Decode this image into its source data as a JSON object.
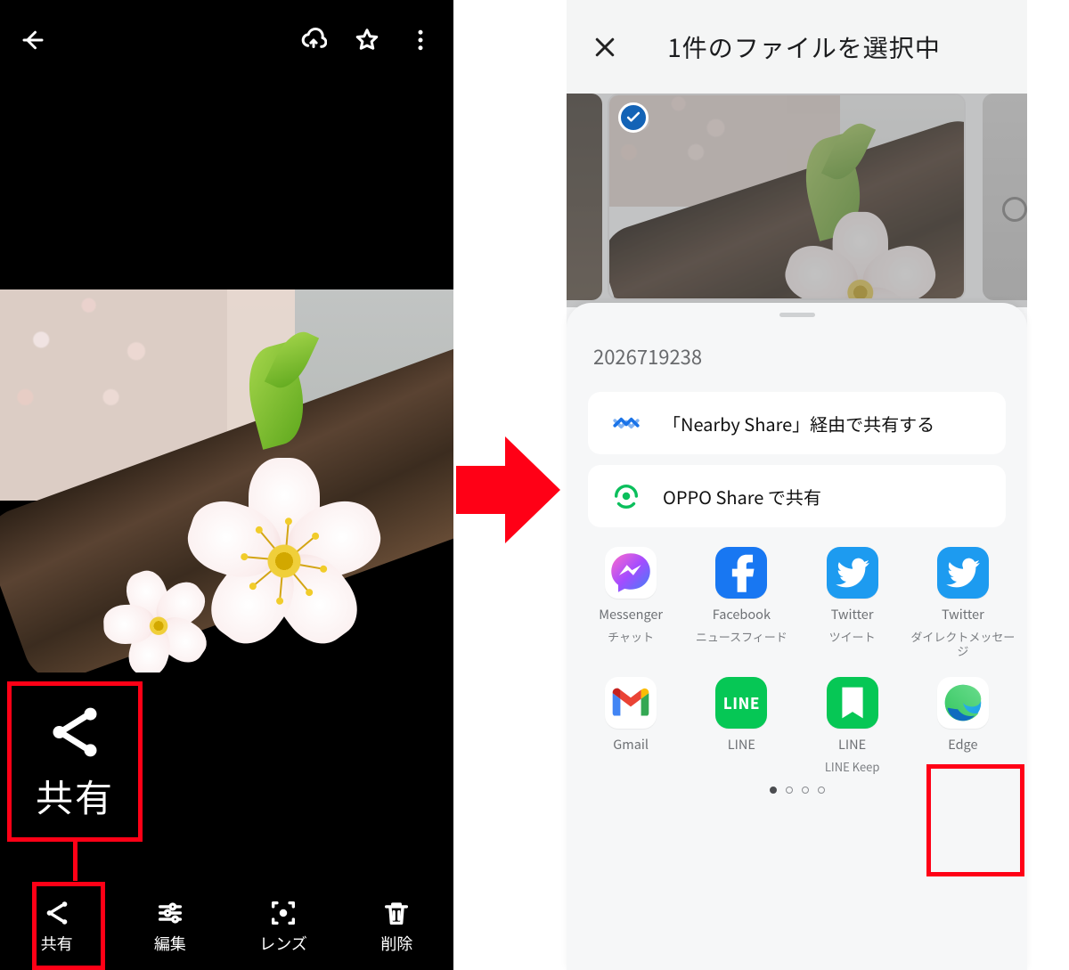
{
  "left": {
    "bottom": [
      {
        "label": "共有",
        "icon": "share-icon"
      },
      {
        "label": "編集",
        "icon": "tune-icon"
      },
      {
        "label": "レンズ",
        "icon": "lens-icon"
      },
      {
        "label": "削除",
        "icon": "trash-icon"
      }
    ],
    "callout_label": "共有"
  },
  "right": {
    "title": "1件のファイルを選択中",
    "share_number": "2026719238",
    "cards": [
      {
        "label": "「Nearby Share」経由で共有する",
        "icon": "nearby-share-icon"
      },
      {
        "label": "OPPO Share で共有",
        "icon": "oppo-share-icon"
      }
    ],
    "apps_row1": [
      {
        "name": "Messenger",
        "sub": "チャット",
        "icon": "messenger-icon"
      },
      {
        "name": "Facebook",
        "sub": "ニュースフィード",
        "icon": "facebook-icon"
      },
      {
        "name": "Twitter",
        "sub": "ツイート",
        "icon": "twitter-icon"
      },
      {
        "name": "Twitter",
        "sub": "ダイレクトメッセージ",
        "icon": "twitter-icon"
      }
    ],
    "apps_row2": [
      {
        "name": "Gmail",
        "sub": "",
        "icon": "gmail-icon"
      },
      {
        "name": "LINE",
        "sub": "",
        "icon": "line-icon"
      },
      {
        "name": "LINE",
        "sub": "LINE Keep",
        "icon": "line-keep-icon"
      },
      {
        "name": "Edge",
        "sub": "",
        "icon": "edge-icon"
      }
    ],
    "pager": {
      "total": 4,
      "active": 0
    }
  }
}
